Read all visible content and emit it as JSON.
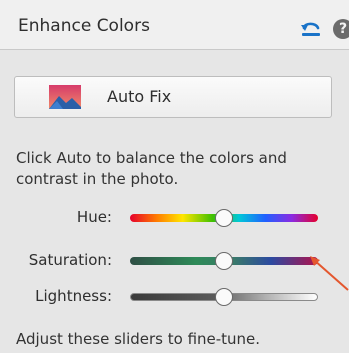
{
  "panel": {
    "title": "Enhance Colors"
  },
  "toolbar": {
    "undo_icon": "undo-arrow-icon",
    "help_icon": "help-icon",
    "help_glyph": "?"
  },
  "auto_fix": {
    "label": "Auto Fix",
    "icon": "photo-icon"
  },
  "description": "Click Auto to balance the colors and contrast in the photo.",
  "sliders": [
    {
      "label": "Hue:",
      "value": 0.5
    },
    {
      "label": "Saturation:",
      "value": 0.5
    },
    {
      "label": "Lightness:",
      "value": 0.5
    }
  ],
  "footer": "Adjust these sliders to fine-tune.",
  "colors": {
    "accent_blue": "#1a73c8",
    "annotation_arrow": "#e4572e"
  }
}
